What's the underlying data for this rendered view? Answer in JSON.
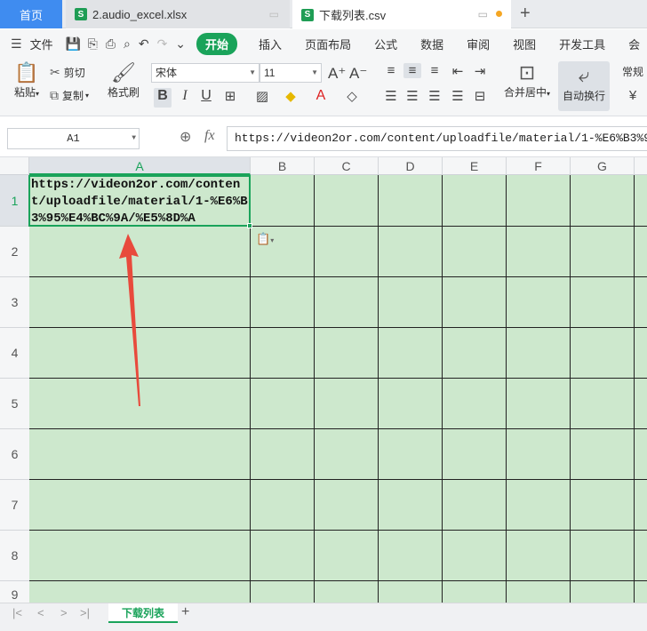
{
  "tabs": {
    "home": "首页",
    "excel": "2.audio_excel.xlsx",
    "csv": "下载列表.csv",
    "new_tab": "+"
  },
  "menu": {
    "file": "文件",
    "items": [
      "开始",
      "插入",
      "页面布局",
      "公式",
      "数据",
      "审阅",
      "视图",
      "开发工具",
      "会"
    ]
  },
  "ribbon": {
    "paste": "粘贴",
    "cut": "剪切",
    "copy": "复制",
    "format_painter": "格式刷",
    "font_name": "宋体",
    "font_size": "11",
    "merge_center": "合并居中",
    "wrap_text": "自动换行",
    "number_format": "常规",
    "currency": "¥"
  },
  "formula_bar": {
    "cell_ref": "A1",
    "fx": "fx",
    "content": "https://videon2or.com/content/uploadfile/material/1-%E6%B3%95%E4%BC%9A/%E5%8D%A"
  },
  "grid": {
    "columns": [
      "A",
      "B",
      "C",
      "D",
      "E",
      "F",
      "G"
    ],
    "rows": [
      "1",
      "2",
      "3",
      "4",
      "5",
      "6",
      "7",
      "8",
      "9"
    ],
    "a1_value": "https://videon2or.com/content/uploadfile/material/1-%E6%B3%95%E4%BC%9A/%E5%8D%A"
  },
  "sheets": {
    "active": "下载列表",
    "add": "+"
  },
  "colors": {
    "accent": "#1aa35a",
    "cell_bg": "#cde8cd",
    "arrow": "#e84a3c",
    "home_tab": "#3f8cf0"
  }
}
